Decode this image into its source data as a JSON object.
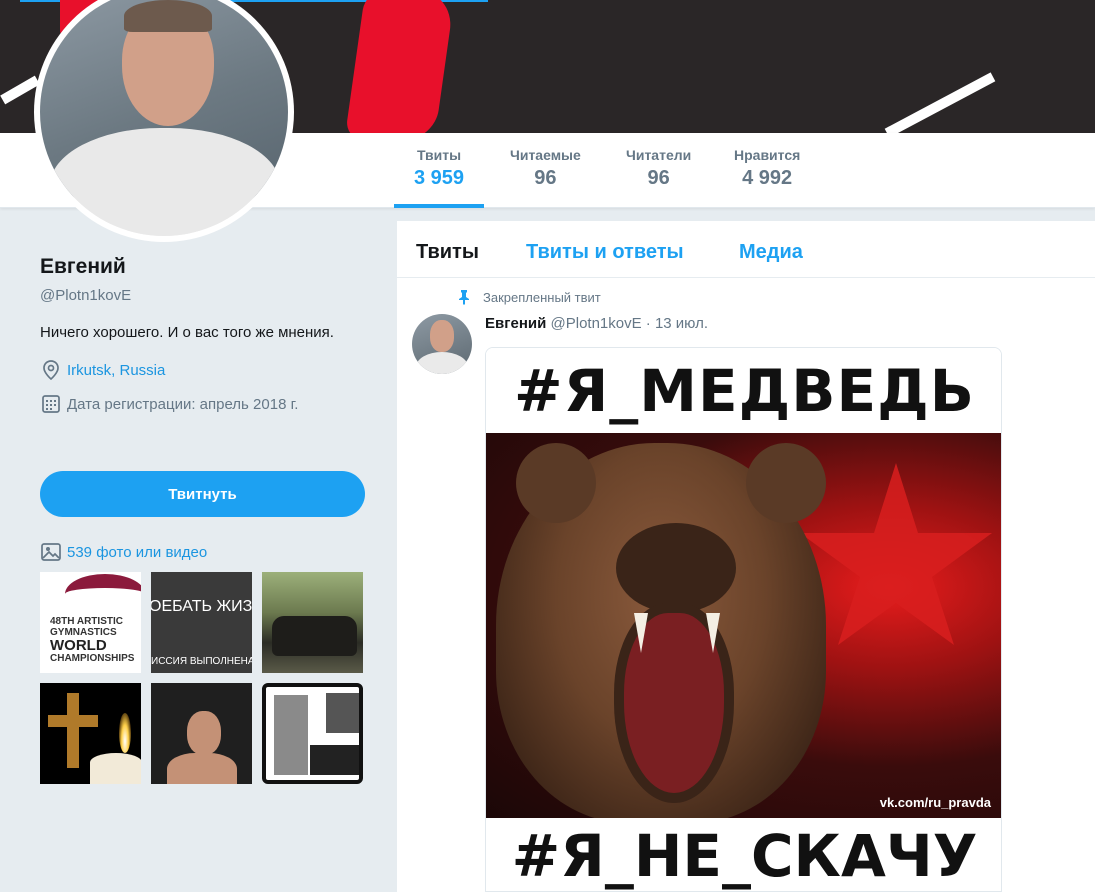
{
  "stats": [
    {
      "label": "Твиты",
      "value": "3 959"
    },
    {
      "label": "Читаемые",
      "value": "96"
    },
    {
      "label": "Читатели",
      "value": "96"
    },
    {
      "label": "Нравится",
      "value": "4 992"
    }
  ],
  "profile": {
    "name": "Евгений",
    "handle": "@Plotn1kovE",
    "bio": "Ничего хорошего. И о вас того же мнения.",
    "location": "Irkutsk, Russia",
    "joined": "Дата регистрации: апрель 2018 г.",
    "tweet_button": "Твитнуть",
    "media_link": "539 фото или видео"
  },
  "thumbnails": {
    "t1_line1": "48TH ARTISTIC",
    "t1_line2": "GYMNASTICS",
    "t1_line3": "WORLD",
    "t1_line4": "CHAMPIONSHIPS",
    "t2_line1": "ОЕБАТЬ ЖИЗ",
    "t2_line2": "ИССИЯ ВЫПОЛНЕНА"
  },
  "tabs": [
    "Твиты",
    "Твиты и ответы",
    "Медиа"
  ],
  "pinned_tweet": {
    "pinned_label": "Закрепленный твит",
    "author_name": "Евгений",
    "author_handle": "@Plotn1kovE",
    "date": "· 13 июл.",
    "image_top_text": "#Я_МЕДВЕДЬ",
    "image_bottom_text": "#Я_НЕ_СКАЧУ",
    "image_credit": "vk.com/ru_pravda"
  },
  "colors": {
    "accent": "#1da1f2",
    "banner_red": "#e8102b",
    "banner_dark": "#2a2627",
    "page_bg": "#e6ecf0"
  },
  "icons": [
    "location-pin-icon",
    "calendar-icon",
    "image-icon",
    "pin-icon"
  ]
}
